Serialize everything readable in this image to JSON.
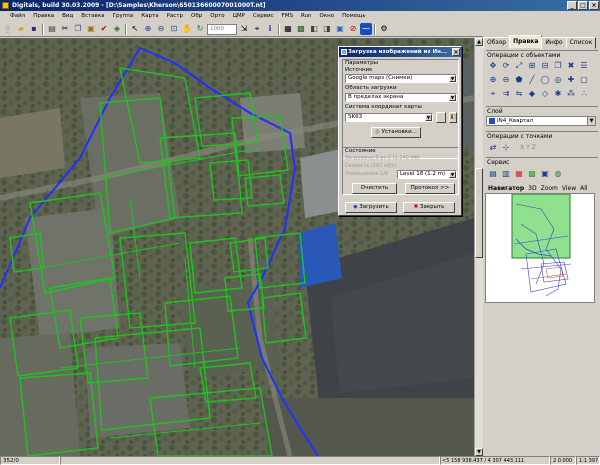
{
  "window": {
    "title": "Digitals, build 30.03.2009 - [D:\\Samples\\Kherson\\65013660007001000T.nt]"
  },
  "menubar": {
    "items": [
      "Файл",
      "Правка",
      "Вид",
      "Вставка",
      "Группа",
      "Карта",
      "Растр",
      "Обр",
      "Орто",
      "ЦМР",
      "Сервис",
      "FMS",
      "Run",
      "Окно",
      "Помощь"
    ]
  },
  "toolbar": {
    "scale_value": "1000"
  },
  "right_panel": {
    "tabs": [
      "Обзор",
      "Правка",
      "Инфо",
      "Список"
    ],
    "active_tab": "Правка",
    "objects_ops_title": "Операции с объектами",
    "layer_title": "Слой",
    "layer_value": "IN4_Квартал",
    "point_ops_title": "Операции с точками",
    "point_ops_xyz": "X Y Z",
    "service_title": "Сервис",
    "nav_tabs": [
      "Навигатор",
      "3D",
      "Zoom",
      "View",
      "All"
    ],
    "active_nav_tab": "Навигатор"
  },
  "dialog": {
    "title": "Загрузка изображений из Ин...",
    "params_label": "Параметры",
    "source_label": "Источник",
    "source_value": "Google maps (Снимки)",
    "area_label": "Область загрузки",
    "area_value": "В пределах экрана",
    "crs_label": "Система координат карты",
    "crs_value": "SK63",
    "settings_button": "Установки...",
    "state_label": "Состояние",
    "loaded_text": "Загружено 0 из 0 (1.340 Мб)",
    "speed_text": "Скорость (181 кб/с)",
    "zoom_label": "Уменьшение 1/8",
    "level_value": "Level 18 (1.2 m)",
    "clear_button": "Очистить",
    "protocol_button": "Протокол >>",
    "load_button": "Загрузить",
    "close_button": "Закрыть"
  },
  "statusbar": {
    "cell1": "352/0",
    "coords": "<5 158 938.437 / 4 307 443.111",
    "scale_a": "2 0.000",
    "scale_b": "1:1 397"
  },
  "colors": {
    "parcel_line": "#1fc21f",
    "boundary_line": "#2030ff",
    "titlebar": "#0a246a"
  }
}
